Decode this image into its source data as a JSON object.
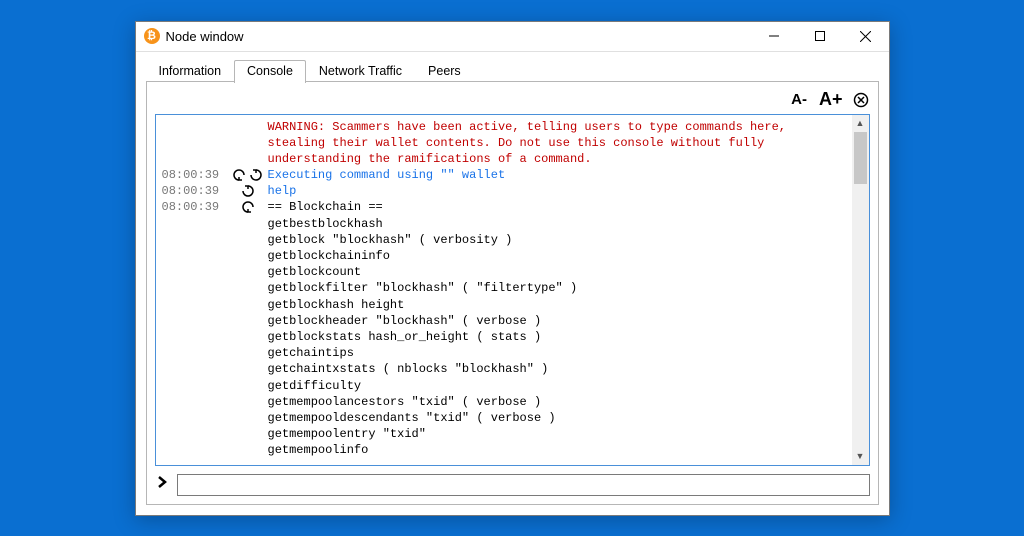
{
  "window": {
    "title": "Node window"
  },
  "tabs": {
    "information": "Information",
    "console": "Console",
    "network": "Network Traffic",
    "peers": "Peers"
  },
  "toolbar": {
    "font_smaller": "A-",
    "font_bigger": "A+"
  },
  "console": {
    "warning": "WARNING: Scammers have been active, telling users to type commands here, stealing their wallet contents. Do not use this console without fully understanding the ramifications of a command.",
    "rows": [
      {
        "ts": "08:00:39",
        "icon": "out-in",
        "class": "info",
        "text": "Executing command using \"\" wallet"
      },
      {
        "ts": "08:00:39",
        "icon": "out",
        "class": "info",
        "text": "help"
      },
      {
        "ts": "08:00:39",
        "icon": "in",
        "class": "plain",
        "text": "== Blockchain ==\ngetbestblockhash\ngetblock \"blockhash\" ( verbosity )\ngetblockchaininfo\ngetblockcount\ngetblockfilter \"blockhash\" ( \"filtertype\" )\ngetblockhash height\ngetblockheader \"blockhash\" ( verbose )\ngetblockstats hash_or_height ( stats )\ngetchaintips\ngetchaintxstats ( nblocks \"blockhash\" )\ngetdifficulty\ngetmempoolancestors \"txid\" ( verbose )\ngetmempooldescendants \"txid\" ( verbose )\ngetmempoolentry \"txid\"\ngetmempoolinfo"
      }
    ]
  },
  "input": {
    "prompt": "❯",
    "value": ""
  }
}
